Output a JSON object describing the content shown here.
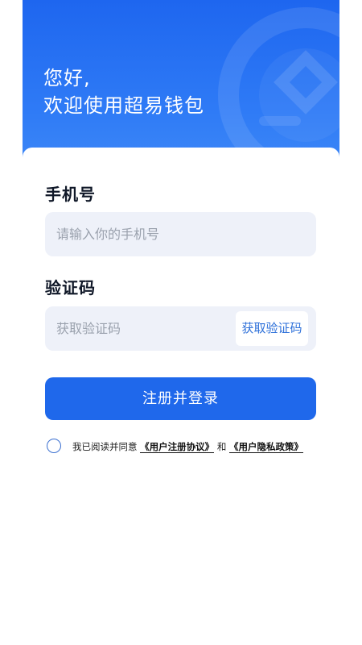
{
  "header": {
    "greeting_line1": "您好,",
    "greeting_line2": "欢迎使用超易钱包"
  },
  "form": {
    "phone_label": "手机号",
    "phone_placeholder": "请输入你的手机号",
    "code_label": "验证码",
    "code_placeholder": "获取验证码",
    "get_code_button": "获取验证码",
    "submit_button": "注册并登录"
  },
  "agreement": {
    "prefix": "我已阅读并同意",
    "terms_link": "《用户注册协议》",
    "conjunction": "和",
    "privacy_link": "《用户隐私政策》",
    "checked": false
  },
  "colors": {
    "primary": "#1f68eb",
    "header_gradient_top": "#1e66ef",
    "input_bg": "#eef1f9",
    "link_blue": "#2c6fd9"
  }
}
